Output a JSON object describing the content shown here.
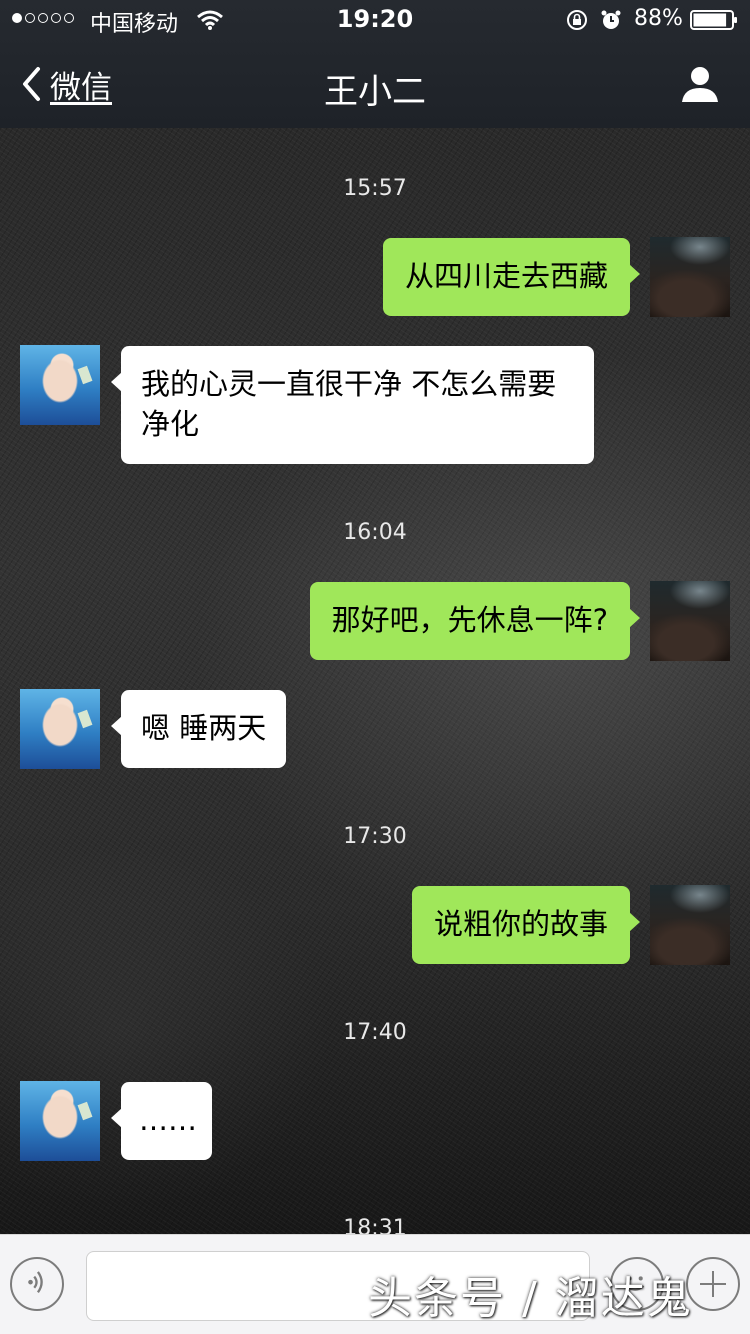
{
  "status_bar": {
    "carrier": "中国移动",
    "time": "19:20",
    "battery_percent": "88%",
    "battery_level": 0.88,
    "signal_bars_filled": 1,
    "signal_bars_total": 5
  },
  "nav": {
    "back_label": "微信",
    "title": "王小二"
  },
  "chat": {
    "timestamps": [
      "15:57",
      "16:04",
      "17:30",
      "17:40",
      "18:31"
    ],
    "messages": [
      {
        "side": "right",
        "text": "从四川走去西藏"
      },
      {
        "side": "left",
        "text": "我的心灵一直很干净 不怎么需要净化"
      },
      {
        "side": "right",
        "text": "那好吧，先休息一阵?"
      },
      {
        "side": "left",
        "text": "嗯 睡两天"
      },
      {
        "side": "right",
        "text": "说粗你的故事"
      },
      {
        "side": "left",
        "text": "……"
      }
    ]
  },
  "input_bar": {
    "text_value": "",
    "watermark": "头条号 / 溜达鬼"
  },
  "colors": {
    "outgoing_bubble": "#a0e75a",
    "incoming_bubble": "#ffffff",
    "nav_background": "#22262c"
  }
}
